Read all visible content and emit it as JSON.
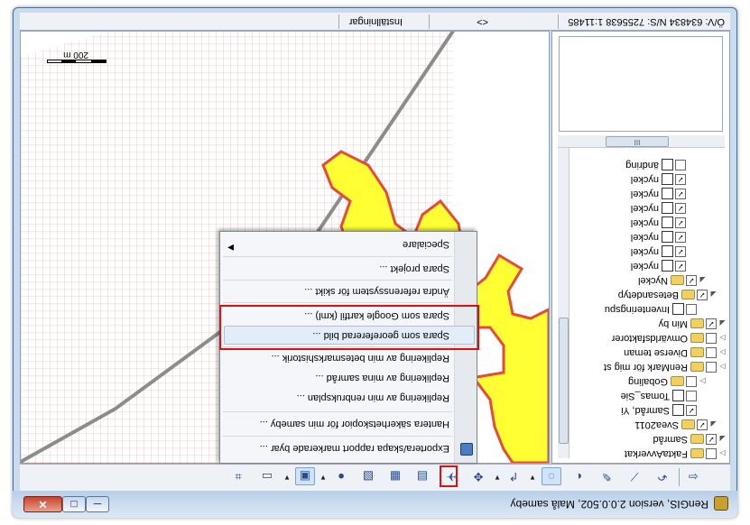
{
  "window": {
    "title": "RenGIS, version 2.0.0.502, Malå sameby",
    "minimize_symbol": "─",
    "maximize_symbol": "□",
    "close_symbol": "✕"
  },
  "status_bar": {
    "coordinates": "Ö/V: 634834 N/S: 7255638 1:11485",
    "arrows": "<>",
    "settings": "Inställningar"
  },
  "map": {
    "scale_label": "200 m",
    "colors": {
      "parcel_fill": "#ffff33",
      "parcel_border": "#e84a3a",
      "grid": "#f0a0a0",
      "boundary": "#8c8c8c"
    }
  },
  "layer_tree": [
    {
      "label": "FaktaAvverkat",
      "expand": "▷",
      "check": "",
      "type": "folder"
    },
    {
      "label": "Samråd",
      "expand": "◢",
      "check": "✓",
      "type": "folder"
    },
    {
      "label": "Svea2011",
      "expand": "◢",
      "check": "✓",
      "type": "folder"
    },
    {
      "label": "Samråd, Yi",
      "expand": "",
      "check": "✓",
      "type": "layer"
    },
    {
      "label": "Tomas_Sie",
      "expand": "",
      "check": "",
      "type": "layer"
    },
    {
      "label": "Gobaling",
      "expand": "▷",
      "check": "",
      "type": "folder"
    },
    {
      "label": "RenMark för mig st",
      "expand": "▷",
      "check": "",
      "type": "folder"
    },
    {
      "label": "Diverse teman",
      "expand": "▷",
      "check": "",
      "type": "folder"
    },
    {
      "label": "Omvärldsfaktorer",
      "expand": "▷",
      "check": "",
      "type": "folder"
    },
    {
      "label": "Min by",
      "expand": "◢",
      "check": "✓",
      "type": "folder"
    },
    {
      "label": "Inventeringspu",
      "expand": "",
      "check": "",
      "type": "layer"
    },
    {
      "label": "Betesandetyp",
      "expand": "◢",
      "check": "✓",
      "type": "folder"
    },
    {
      "label": "Nyckel",
      "expand": "◢",
      "check": "✓",
      "type": "folder"
    },
    {
      "label": "nyckel",
      "expand": "",
      "check": "✓",
      "type": "layer"
    },
    {
      "label": "nyckel",
      "expand": "",
      "check": "✓",
      "type": "layer"
    },
    {
      "label": "nyckel",
      "expand": "",
      "check": "✓",
      "type": "layer"
    },
    {
      "label": "nyckel",
      "expand": "",
      "check": "✓",
      "type": "layer"
    },
    {
      "label": "nyckel",
      "expand": "",
      "check": "✓",
      "type": "layer"
    },
    {
      "label": "nyckel",
      "expand": "",
      "check": "✓",
      "type": "layer"
    },
    {
      "label": "nyckel",
      "expand": "",
      "check": "✓",
      "type": "layer"
    },
    {
      "label": "ändring",
      "expand": "",
      "check": "",
      "type": "layer"
    }
  ],
  "hscroll_label": "III",
  "context_menu": {
    "items": [
      "Exportera/skapa rapport markerade byar ...",
      "Hantera säkerhetskopior för min sameby ...",
      "Replikering av min renbruksplan ...",
      "Replikering av mina samråd ...",
      "Replikering av min betesmarkshistorik ...",
      "Spara som georefererad bild ...",
      "Spara som Google kartfil (kml) ...",
      "Ändra referenssystem för skikt ...",
      "Spara projekt ...",
      "Specialare"
    ],
    "submenu_arrow": "▶"
  },
  "toolbar": {
    "icons": [
      {
        "name": "back-icon",
        "glyph": "⇦"
      },
      {
        "name": "rotate-icon",
        "glyph": "↶"
      },
      {
        "name": "measure-icon",
        "glyph": "⟋"
      },
      {
        "name": "edit-point-icon",
        "glyph": "✎"
      },
      {
        "name": "globe-icon",
        "glyph": "◐"
      },
      {
        "name": "select-icon",
        "glyph": "◌"
      },
      {
        "name": "draw-line-icon",
        "glyph": "↱"
      },
      {
        "name": "gps-icon",
        "glyph": "✥"
      },
      {
        "name": "print-icon",
        "glyph": "▤"
      },
      {
        "name": "grid-icon",
        "glyph": "▦"
      },
      {
        "name": "satellite-icon",
        "glyph": "✈"
      },
      {
        "name": "layers-icon",
        "glyph": "▧"
      },
      {
        "name": "world-icon",
        "glyph": "●"
      },
      {
        "name": "dropdown-arrow-icon",
        "glyph": "▼"
      },
      {
        "name": "export-icon",
        "glyph": "▣"
      },
      {
        "name": "save-icon",
        "glyph": "▭"
      },
      {
        "name": "zoom-extent-icon",
        "glyph": "⌗"
      }
    ]
  }
}
